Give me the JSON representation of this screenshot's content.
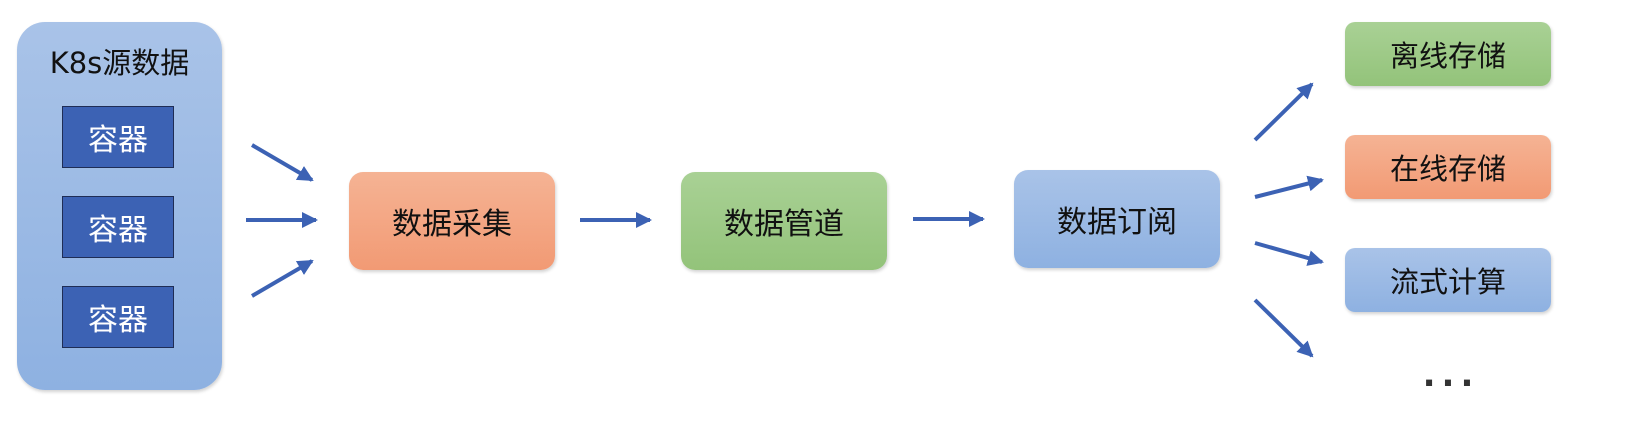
{
  "source": {
    "title": "K8s源数据",
    "containers": [
      "容器",
      "容器",
      "容器"
    ]
  },
  "pipeline": {
    "collect": "数据采集",
    "pipe": "数据管道",
    "subscribe": "数据订阅"
  },
  "outputs": {
    "offline": "离线存储",
    "online": "在线存储",
    "stream": "流式计算",
    "more": "..."
  },
  "colors": {
    "blue_box": "#8eb1e1",
    "container_fill": "#3c62b4",
    "orange_box": "#f29a74",
    "green_box": "#93c37a",
    "arrow": "#3c62b4"
  }
}
